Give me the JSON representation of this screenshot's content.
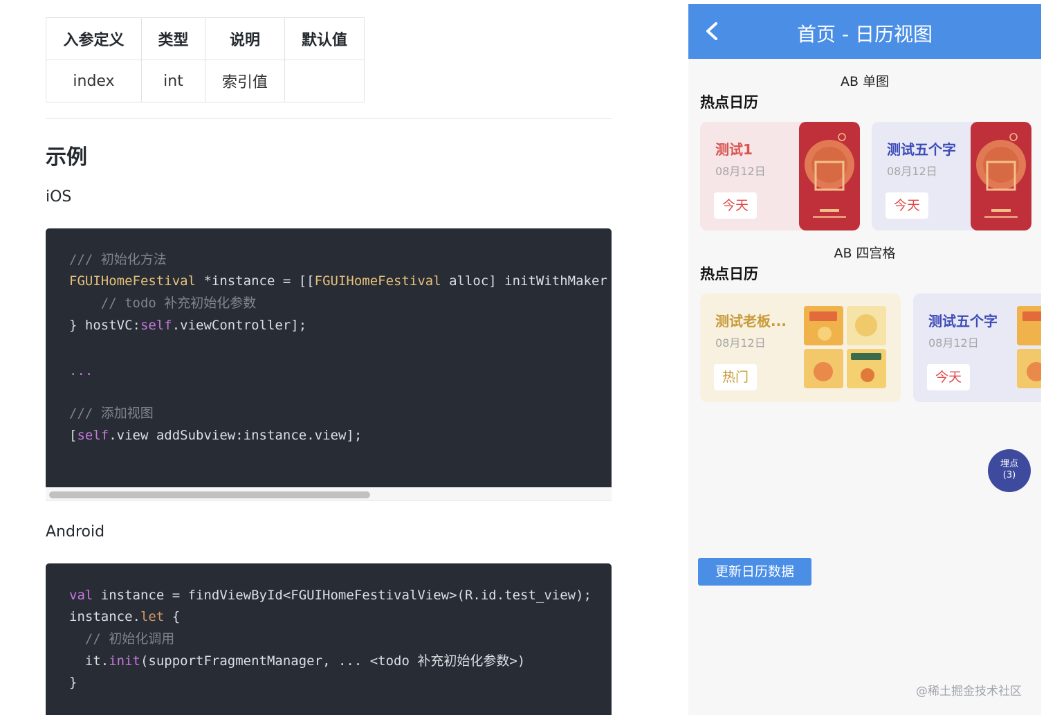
{
  "doc": {
    "table": {
      "headers": [
        "入参定义",
        "类型",
        "说明",
        "默认值"
      ],
      "rows": [
        [
          "index",
          "int",
          "索引值",
          ""
        ]
      ]
    },
    "example_heading": "示例",
    "ios_heading": "iOS",
    "android_heading": "Android",
    "ios_code": {
      "l1": "/// 初始化方法",
      "l2_type1": "FGUIHomeFestival",
      "l2_mid": " *instance = [[",
      "l2_type2": "FGUIHomeFestival",
      "l2_end": " alloc] initWithMaker",
      "l3": "    // todo 补充初始化参数",
      "l4_a": "} hostVC:",
      "l4_kw": "self",
      "l4_b": ".viewController];",
      "l5": "...",
      "l6": "/// 添加视图",
      "l7_a": "[",
      "l7_kw": "self",
      "l7_b": ".view addSubview:instance.view];"
    },
    "android_code": {
      "l1_kw": "val",
      "l1_rest": " instance = findViewById<FGUIHomeFestivalView>(R.id.test_view);",
      "l2_a": "instance.",
      "l2_kw": "let",
      "l2_b": " {",
      "l3": "  // 初始化调用",
      "l4_a": "  it.",
      "l4_kw": "init",
      "l4_b": "(supportFragmentManager, ... <todo 补充初始化参数>)",
      "l5": "}"
    }
  },
  "phone": {
    "nav_title": "首页 - 日历视图",
    "section1_label": "AB 单图",
    "section1_title": "热点日历",
    "section2_label": "AB 四宫格",
    "section2_title": "热点日历",
    "single_cards": [
      {
        "title": "测试1",
        "date": "08月12日",
        "badge": "今天",
        "title_color": "#d9534f",
        "bg": "#f6e6e8"
      },
      {
        "title": "测试五个字",
        "date": "08月12日",
        "badge": "今天",
        "title_color": "#3c4bb8",
        "bg": "#e8e9f5"
      }
    ],
    "grid_cards": [
      {
        "title": "测试老板...",
        "date": "08月12日",
        "badge": "热门",
        "title_color": "#c99a3a",
        "bg": "#f8f1e0"
      },
      {
        "title": "测试五个字",
        "date": "08月12日",
        "badge": "今天",
        "title_color": "#3c4bb8",
        "bg": "#e8e9f5"
      }
    ],
    "float_button": {
      "line1": "埋点",
      "line2": "(3)"
    },
    "update_button": "更新日历数据",
    "colors": {
      "nav": "#4a8ee6",
      "poster_red": "#c0303a",
      "badge_red": "#e04848"
    }
  },
  "watermark": "@稀土掘金技术社区"
}
